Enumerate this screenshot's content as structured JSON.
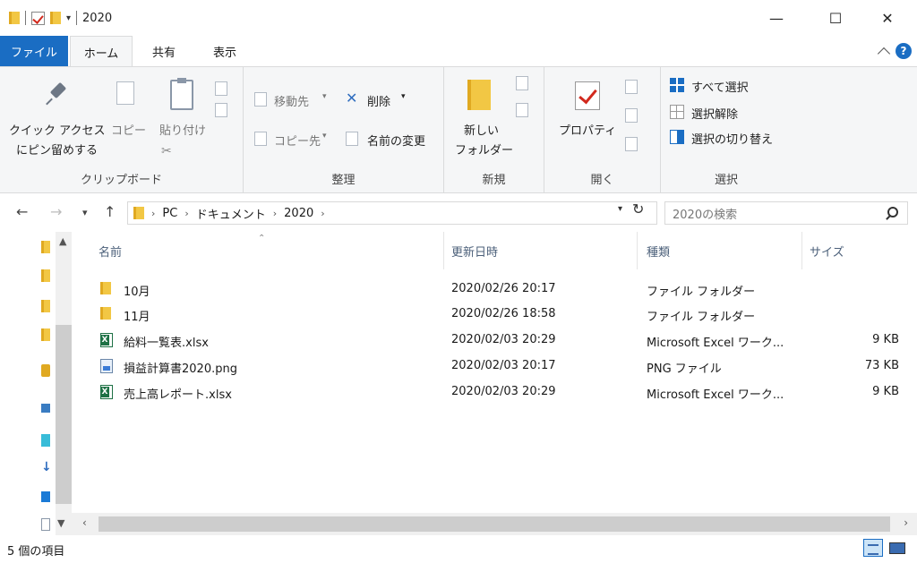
{
  "window": {
    "title": "2020",
    "minimize": "—",
    "maximize": "☐",
    "close": "✕"
  },
  "tabs": {
    "file": "ファイル",
    "home": "ホーム",
    "share": "共有",
    "view": "表示",
    "help": "?"
  },
  "ribbon": {
    "clipboard": {
      "label": "クリップボード",
      "pin_line1": "クイック アクセス",
      "pin_line2": "にピン留めする",
      "copy": "コピー",
      "paste": "貼り付け"
    },
    "organize": {
      "label": "整理",
      "move_to": "移動先",
      "copy_to": "コピー先",
      "delete": "削除",
      "rename": "名前の変更"
    },
    "new": {
      "label": "新規",
      "new_folder_line1": "新しい",
      "new_folder_line2": "フォルダー"
    },
    "open": {
      "label": "開く",
      "properties": "プロパティ"
    },
    "select": {
      "label": "選択",
      "select_all": "すべて選択",
      "select_none": "選択解除",
      "invert": "選択の切り替え"
    }
  },
  "address": {
    "crumbs": [
      "PC",
      "ドキュメント",
      "2020"
    ],
    "search_placeholder": "2020の検索"
  },
  "columns": {
    "name": "名前",
    "modified": "更新日時",
    "type": "種類",
    "size": "サイズ"
  },
  "files": [
    {
      "name": "10月",
      "modified": "2020/02/26 20:17",
      "type": "ファイル フォルダー",
      "size": "",
      "icon": "folder-icon"
    },
    {
      "name": "11月",
      "modified": "2020/02/26 18:58",
      "type": "ファイル フォルダー",
      "size": "",
      "icon": "folder-icon"
    },
    {
      "name": "給料一覧表.xlsx",
      "modified": "2020/02/03 20:29",
      "type": "Microsoft Excel ワーク...",
      "size": "9 KB",
      "icon": "excel-file-icon"
    },
    {
      "name": "損益計算書2020.png",
      "modified": "2020/02/03 20:17",
      "type": "PNG ファイル",
      "size": "73 KB",
      "icon": "png-file-icon"
    },
    {
      "name": "売上高レポート.xlsx",
      "modified": "2020/02/03 20:29",
      "type": "Microsoft Excel ワーク...",
      "size": "9 KB",
      "icon": "excel-file-icon"
    }
  ],
  "status": {
    "item_count": "5 個の項目"
  },
  "colors": {
    "accent": "#1a6dc3",
    "folder": "#f2c744",
    "excel": "#1e7145"
  }
}
